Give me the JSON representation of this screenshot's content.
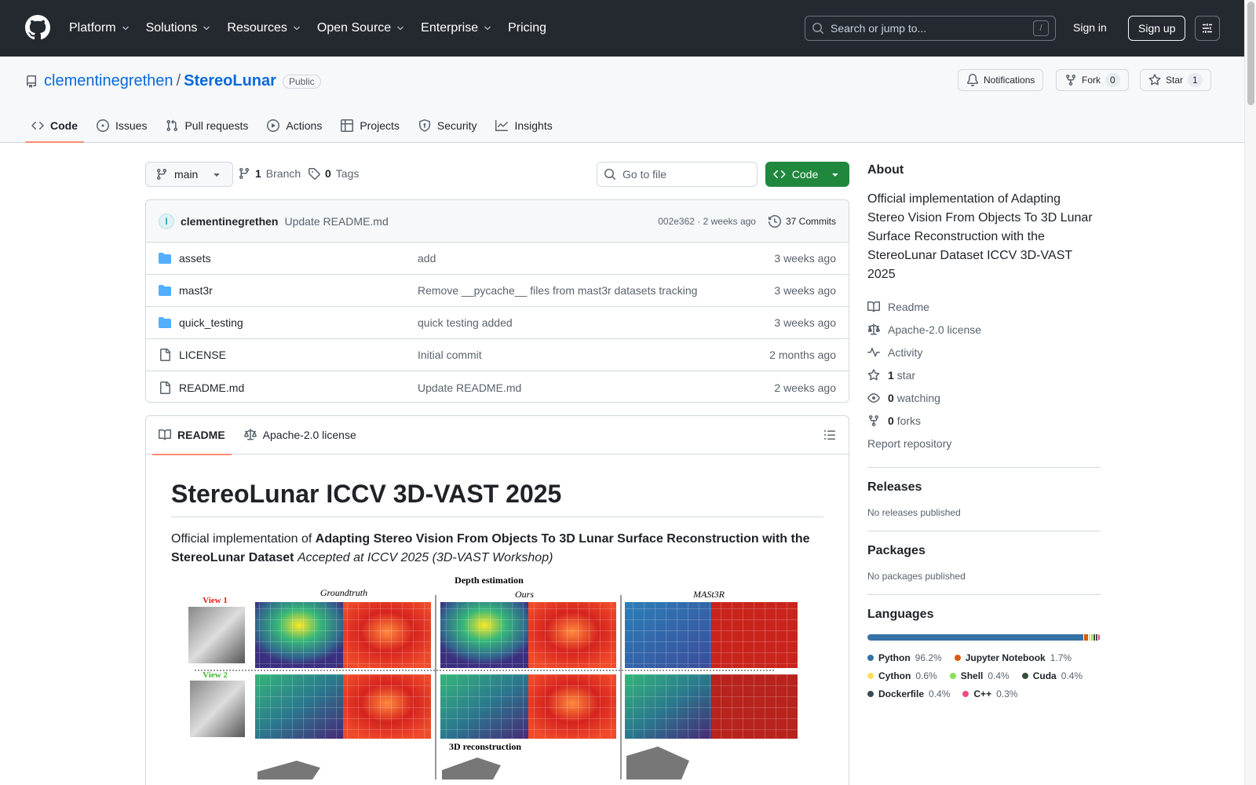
{
  "header": {
    "nav": [
      "Platform",
      "Solutions",
      "Resources",
      "Open Source",
      "Enterprise",
      "Pricing"
    ],
    "search_placeholder": "Search or jump to...",
    "search_shortcut": "/",
    "signin": "Sign in",
    "signup": "Sign up"
  },
  "repo": {
    "owner": "clementinegrethen",
    "separator": "/",
    "name": "StereoLunar",
    "visibility": "Public",
    "notifications": "Notifications",
    "fork_label": "Fork",
    "fork_count": "0",
    "star_label": "Star",
    "star_count": "1",
    "tabs": [
      "Code",
      "Issues",
      "Pull requests",
      "Actions",
      "Projects",
      "Security",
      "Insights"
    ]
  },
  "browser": {
    "branch": "main",
    "branch_count": "1",
    "branch_label": "Branch",
    "tag_count": "0",
    "tag_label": "Tags",
    "goto_placeholder": "Go to file",
    "code_button": "Code",
    "latest_commit": {
      "avatar_letter": "I",
      "author": "clementinegrethen",
      "message": "Update README.md",
      "sha_time": "002e362 · 2 weeks ago",
      "commits": "37 Commits"
    },
    "files": [
      {
        "type": "dir",
        "name": "assets",
        "message": "add",
        "date": "3 weeks ago"
      },
      {
        "type": "dir",
        "name": "mast3r",
        "message": "Remove __pycache__ files from mast3r datasets tracking",
        "date": "3 weeks ago"
      },
      {
        "type": "dir",
        "name": "quick_testing",
        "message": "quick testing added",
        "date": "3 weeks ago"
      },
      {
        "type": "file",
        "name": "LICENSE",
        "message": "Initial commit",
        "date": "2 months ago"
      },
      {
        "type": "file",
        "name": "README.md",
        "message": "Update README.md",
        "date": "2 weeks ago"
      }
    ]
  },
  "readme": {
    "tab_readme": "README",
    "tab_license": "Apache-2.0 license",
    "title": "StereoLunar ICCV 3D-VAST 2025",
    "intro_prefix": "Official implementation of ",
    "intro_bold": "Adapting Stereo Vision From Objects To 3D Lunar Surface Reconstruction with the StereoLunar Dataset",
    "intro_italic": "Accepted at ICCV 2025 (3D-VAST Workshop)",
    "figure": {
      "top_title": "Depth estimation",
      "col_groundtruth": "Groundtruth",
      "col_ours": "Ours",
      "col_mast3r": "MASt3R",
      "view1": "View 1",
      "view2": "View 2",
      "bottom_title": "3D reconstruction"
    }
  },
  "sidebar": {
    "about_title": "About",
    "description": "Official implementation of Adapting Stereo Vision From Objects To 3D Lunar Surface Reconstruction with the StereoLunar Dataset ICCV 3D-VAST 2025",
    "readme": "Readme",
    "license": "Apache-2.0 license",
    "activity": "Activity",
    "stars_count": "1",
    "stars_label": "star",
    "watching_count": "0",
    "watching_label": "watching",
    "forks_count": "0",
    "forks_label": "forks",
    "report": "Report repository",
    "releases_title": "Releases",
    "releases_text": "No releases published",
    "packages_title": "Packages",
    "packages_text": "No packages published",
    "languages_title": "Languages",
    "languages": [
      {
        "name": "Python",
        "percent": "96.2%",
        "value": 96.2,
        "color": "#3572A5"
      },
      {
        "name": "Jupyter Notebook",
        "percent": "1.7%",
        "value": 1.7,
        "color": "#DA5B0B"
      },
      {
        "name": "Cython",
        "percent": "0.6%",
        "value": 0.6,
        "color": "#fedf5b"
      },
      {
        "name": "Shell",
        "percent": "0.4%",
        "value": 0.4,
        "color": "#89e051"
      },
      {
        "name": "Cuda",
        "percent": "0.4%",
        "value": 0.4,
        "color": "#3A4E3A"
      },
      {
        "name": "Dockerfile",
        "percent": "0.4%",
        "value": 0.4,
        "color": "#384d54"
      },
      {
        "name": "C++",
        "percent": "0.3%",
        "value": 0.3,
        "color": "#f34b7d"
      }
    ]
  }
}
